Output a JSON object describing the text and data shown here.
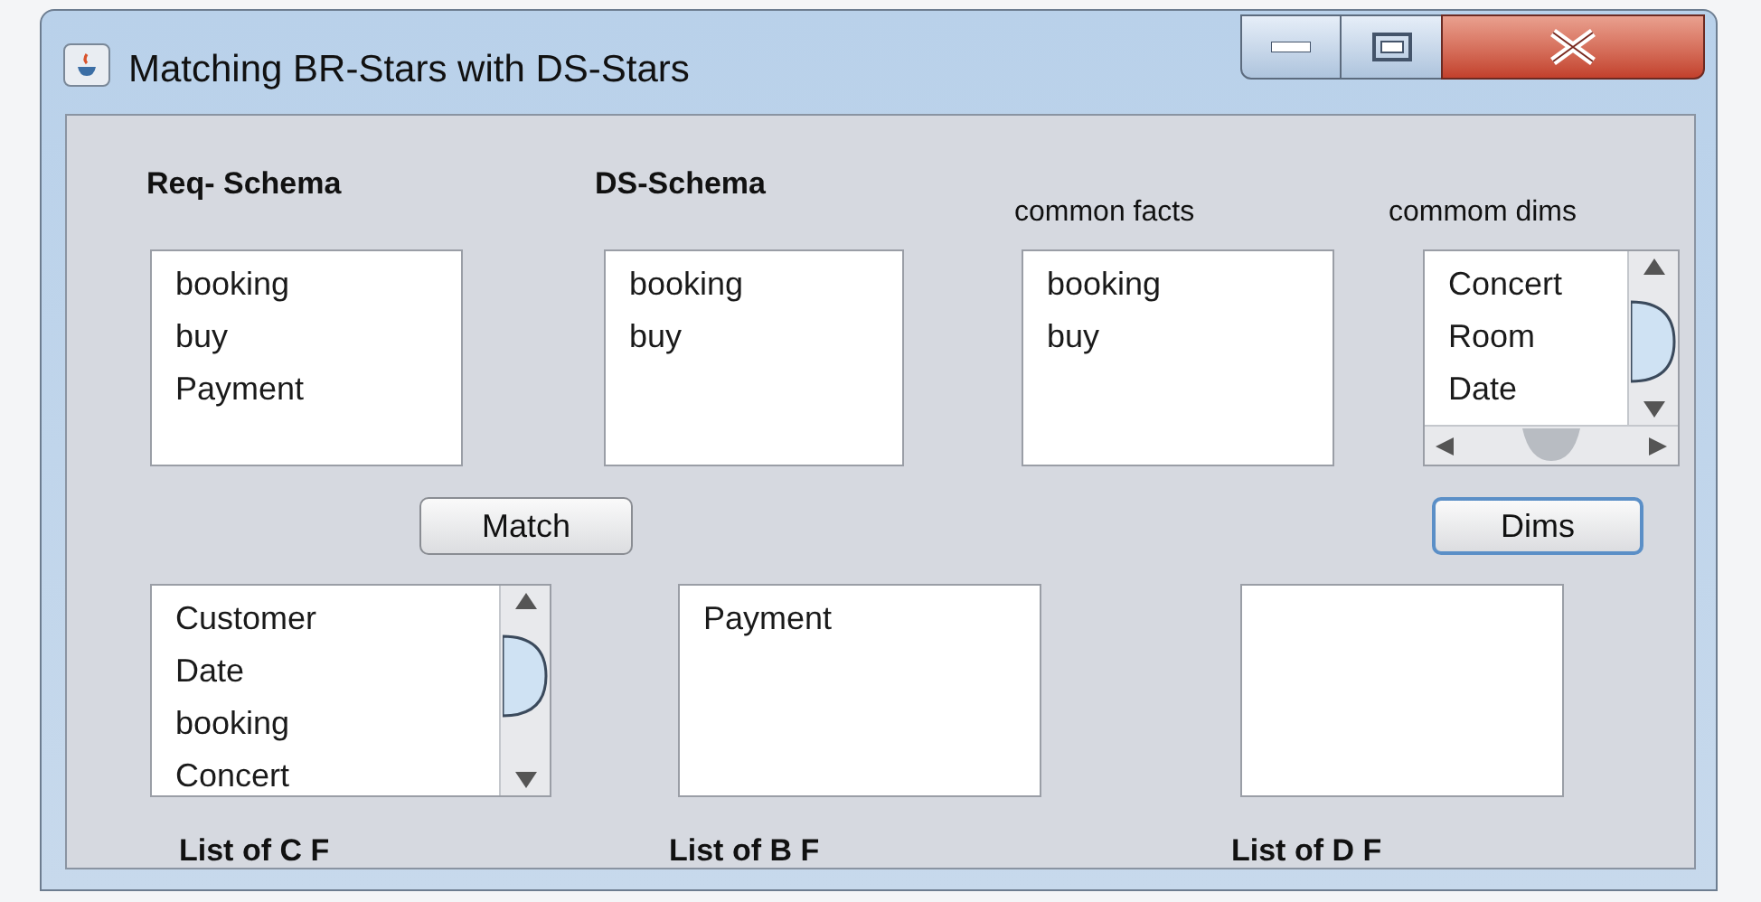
{
  "window": {
    "title": "Matching BR-Stars with DS-Stars"
  },
  "top_lists": [
    {
      "heading": "Req- Schema",
      "heading_bold": true,
      "items": [
        "booking",
        "buy",
        "Payment"
      ],
      "vertical_scrollbar": false,
      "horizontal_scrollbar": false
    },
    {
      "heading": "DS-Schema",
      "heading_bold": true,
      "items": [
        "booking",
        "buy"
      ],
      "vertical_scrollbar": false,
      "horizontal_scrollbar": false
    },
    {
      "heading": "common facts",
      "heading_bold": false,
      "items": [
        "booking",
        "buy"
      ],
      "vertical_scrollbar": false,
      "horizontal_scrollbar": false
    },
    {
      "heading": "commom dims",
      "heading_bold": false,
      "items": [
        "Concert",
        "Room",
        "Date"
      ],
      "vertical_scrollbar": true,
      "horizontal_scrollbar": true
    }
  ],
  "buttons": [
    {
      "label": "Match",
      "focused": false
    },
    {
      "label": "Dims",
      "focused": true
    }
  ],
  "bottom_lists": [
    {
      "label": "List of C F",
      "items": [
        "Customer",
        "Date",
        "booking",
        "Concert"
      ],
      "vertical_scrollbar": true
    },
    {
      "label": "List of B F",
      "items": [
        "Payment"
      ],
      "vertical_scrollbar": false
    },
    {
      "label": "List of D F",
      "vertical_scrollbar": false
    }
  ]
}
